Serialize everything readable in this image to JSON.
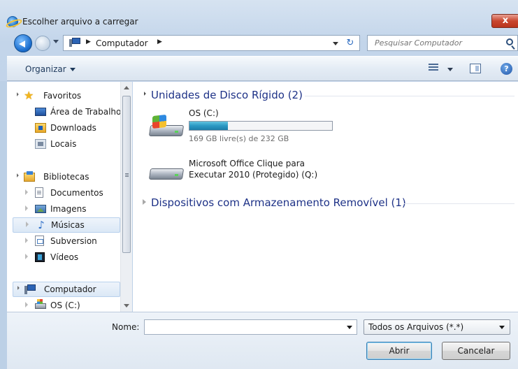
{
  "window": {
    "title": "Escolher arquivo a carregar",
    "close_label": "x"
  },
  "address": {
    "crumb": "Computador",
    "search_placeholder": "Pesquisar Computador"
  },
  "toolbar": {
    "organize_label": "Organizar",
    "help_label": "?"
  },
  "nav": {
    "favorites": "Favoritos",
    "desktop": "Área de Trabalho",
    "downloads": "Downloads",
    "places": "Locais",
    "libraries": "Bibliotecas",
    "documents": "Documentos",
    "images": "Imagens",
    "music": "Músicas",
    "subversion": "Subversion",
    "videos": "Vídeos",
    "computer": "Computador",
    "os_drive": "OS (C:)"
  },
  "content": {
    "hard_disks_header": "Unidades de Disco Rígido (2)",
    "removable_header": "Dispositivos com Armazenamento Removível (1)",
    "drives": [
      {
        "name": "OS (C:)",
        "free_text": "169 GB livre(s) de 232 GB",
        "used_fraction": 0.27
      },
      {
        "name_line1": "Microsoft Office Clique para",
        "name_line2": "Executar 2010 (Protegido) (Q:)"
      }
    ]
  },
  "footer": {
    "name_label": "Nome:",
    "name_value": "",
    "filter_value": "Todos os Arquivos (*.*)",
    "open_label": "Abrir",
    "cancel_label": "Cancelar"
  }
}
